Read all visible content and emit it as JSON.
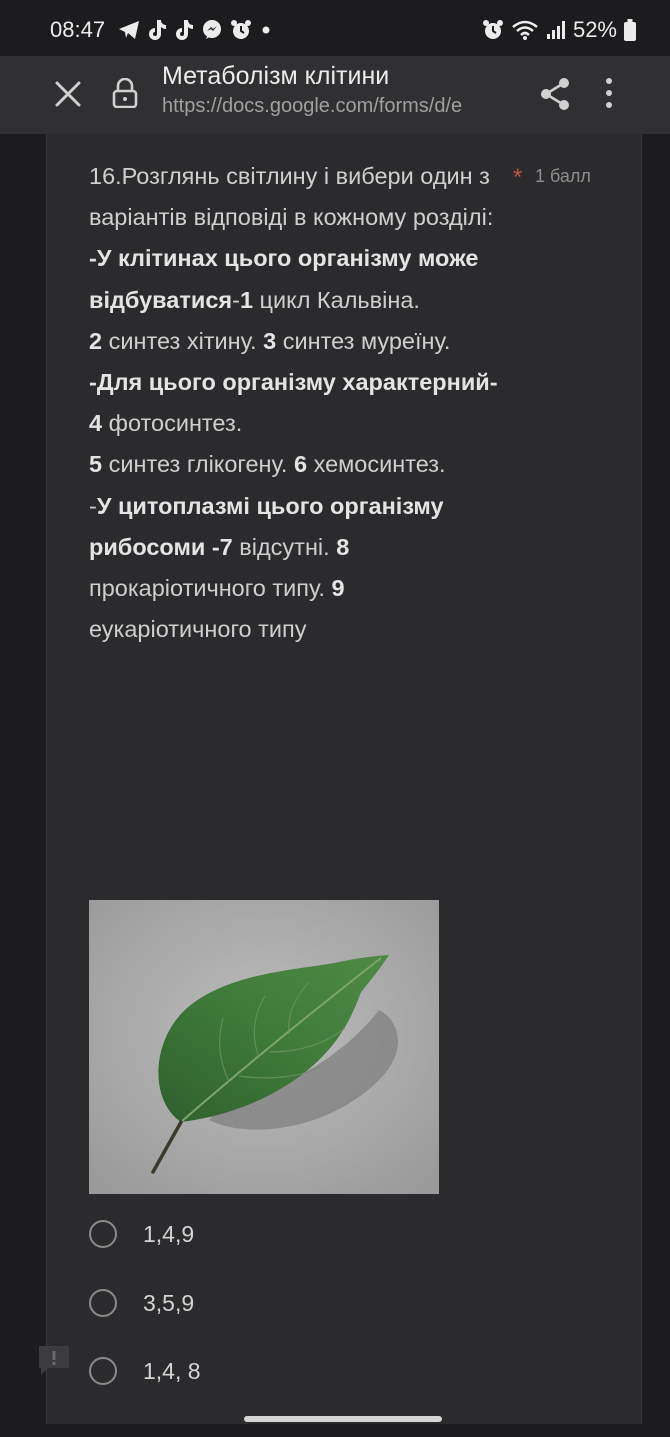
{
  "status_bar": {
    "time": "08:47",
    "battery": "52%",
    "left_icons": [
      "telegram-icon",
      "tiktok-icon",
      "tiktok-icon",
      "messenger-icon",
      "alarm-icon",
      "dot-icon"
    ],
    "right_icons": [
      "alarm-icon",
      "wifi-icon",
      "signal-icon",
      "battery-icon"
    ]
  },
  "app_bar": {
    "title": "Метаболізм клітини",
    "url": "https://docs.google.com/forms/d/e"
  },
  "question": {
    "required_marker": "*",
    "points": "1 балл",
    "text_segments": [
      {
        "text": "16.Розглянь світлину і вибери один з варіантів відповіді в кожному розділі:",
        "bold": false
      },
      {
        "text": "-У клітинах цього організму може відбуватися",
        "bold": true
      },
      {
        "text": "-",
        "bold": false
      },
      {
        "text": "1",
        "bold": true
      },
      {
        "text": " цикл Кальвіна.",
        "bold": false
      },
      {
        "text": "2",
        "bold": true
      },
      {
        "text": " синтез хітину. ",
        "bold": false
      },
      {
        "text": "3",
        "bold": true
      },
      {
        "text": " синтез муреїну.",
        "bold": false
      },
      {
        "text": "-Для цього організму характерний- 4",
        "bold": true
      },
      {
        "text": " фотосинтез.",
        "bold": false
      },
      {
        "text": "5",
        "bold": true
      },
      {
        "text": " синтез глікогену.  ",
        "bold": false
      },
      {
        "text": "6",
        "bold": true
      },
      {
        "text": " хемосинтез.",
        "bold": false
      },
      {
        "text": "-",
        "bold": false
      },
      {
        "text": "У цитоплазмі цього організму рибосоми  -7",
        "bold": true
      },
      {
        "text": " відсутні. ",
        "bold": false
      },
      {
        "text": "8",
        "bold": true
      },
      {
        "text": " прокаріотичного типу. ",
        "bold": false
      },
      {
        "text": "9",
        "bold": true
      },
      {
        "text": " еукаріотичного типу",
        "bold": false
      }
    ],
    "options": [
      "1,4,9",
      "3,5,9",
      "1,4, 8"
    ]
  },
  "colors": {
    "background": "#1c1c1e",
    "app_bar": "#303032",
    "card": "#2b2b2d",
    "required": "#c5504a",
    "leaf": "#3f7a3a"
  }
}
